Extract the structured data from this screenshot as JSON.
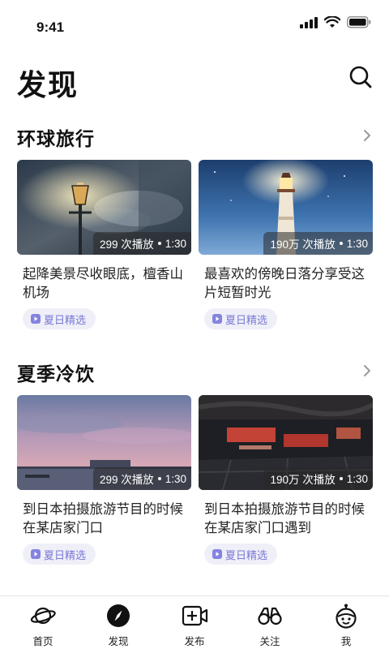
{
  "status_bar": {
    "time": "9:41"
  },
  "header": {
    "title": "发现",
    "search_icon": "search-icon"
  },
  "sections": [
    {
      "title": "环球旅行",
      "cards": [
        {
          "plays": "299 次播放",
          "duration": "1:30",
          "title": "起降美景尽收眼底，檀香山机场",
          "tag": "夏日精选"
        },
        {
          "plays": "190万 次播放",
          "duration": "1:30",
          "title": "最喜欢的傍晚日落分享受这片短暂时光",
          "tag": "夏日精选"
        }
      ]
    },
    {
      "title": "夏季冷饮",
      "cards": [
        {
          "plays": "299 次播放",
          "duration": "1:30",
          "title": "到日本拍摄旅游节目的时候在某店家门口",
          "tag": "夏日精选"
        },
        {
          "plays": "190万 次播放",
          "duration": "1:30",
          "title": "到日本拍摄旅游节目的时候在某店家门口遇到",
          "tag": "夏日精选"
        }
      ]
    }
  ],
  "tab_bar": {
    "active": "发现",
    "items": [
      {
        "label": "首页",
        "icon": "planet-icon"
      },
      {
        "label": "发现",
        "icon": "compass-icon"
      },
      {
        "label": "发布",
        "icon": "video-add-icon"
      },
      {
        "label": "关注",
        "icon": "binoculars-icon"
      },
      {
        "label": "我",
        "icon": "robot-face-icon"
      }
    ]
  }
}
